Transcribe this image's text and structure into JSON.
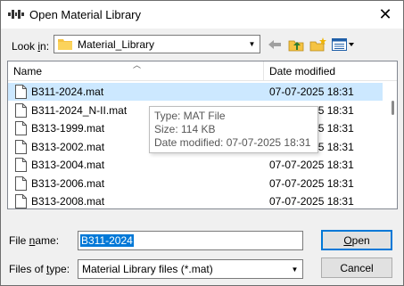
{
  "window": {
    "title": "Open Material Library",
    "close_glyph": "✕"
  },
  "toolbar": {
    "look_in_label_pre": "Look ",
    "look_in_label_u": "i",
    "look_in_label_post": "n:",
    "look_in_value": "Material_Library",
    "icons": [
      "back-arrow-icon",
      "up-folder-icon",
      "new-folder-icon",
      "view-menu-icon"
    ]
  },
  "list": {
    "columns": {
      "name": "Name",
      "date_modified": "Date modified"
    },
    "rows": [
      {
        "name": "B311-2024.mat",
        "date": "07-07-2025 18:31",
        "selected": true
      },
      {
        "name": "B311-2024_N-II.mat",
        "date": "07-07-2025 18:31",
        "selected": false
      },
      {
        "name": "B313-1999.mat",
        "date": "07-07-2025 18:31",
        "selected": false
      },
      {
        "name": "B313-2002.mat",
        "date": "07-07-2025 18:31",
        "selected": false
      },
      {
        "name": "B313-2004.mat",
        "date": "07-07-2025 18:31",
        "selected": false
      },
      {
        "name": "B313-2006.mat",
        "date": "07-07-2025 18:31",
        "selected": false
      },
      {
        "name": "B313-2008.mat",
        "date": "07-07-2025 18:31",
        "selected": false
      }
    ]
  },
  "tooltip": {
    "type": "Type: MAT File",
    "size": "Size: 114 KB",
    "modified": "Date modified: 07-07-2025 18:31"
  },
  "file_name": {
    "label_pre": "File ",
    "label_u": "n",
    "label_post": "ame:",
    "value": "B311-2024"
  },
  "file_type": {
    "label_pre": "Files of ",
    "label_u": "t",
    "label_post": "ype:",
    "value": "Material Library files (*.mat)"
  },
  "buttons": {
    "open_u": "O",
    "open_rest": "pen",
    "cancel": "Cancel"
  },
  "colors": {
    "selection": "#cce8ff",
    "accent": "#0078d7"
  }
}
